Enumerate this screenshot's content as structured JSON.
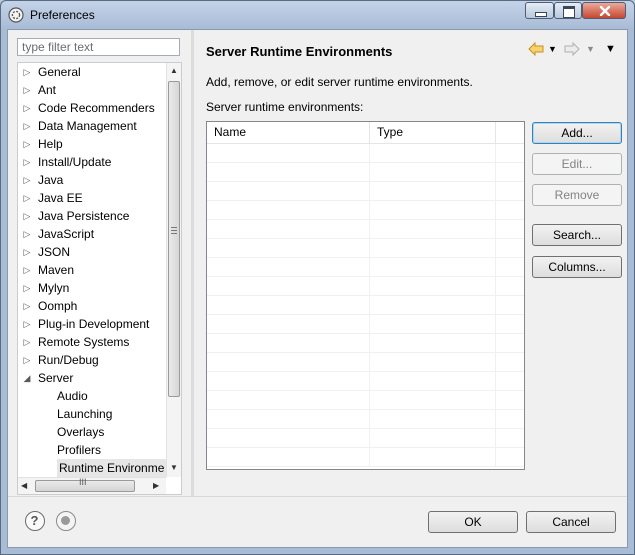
{
  "window": {
    "title": "Preferences"
  },
  "filter": {
    "placeholder": "type filter text"
  },
  "tree": {
    "items": [
      {
        "label": "General",
        "expandable": true,
        "selected": false,
        "level": 0
      },
      {
        "label": "Ant",
        "expandable": true,
        "selected": false,
        "level": 0
      },
      {
        "label": "Code Recommenders",
        "expandable": true,
        "selected": false,
        "level": 0
      },
      {
        "label": "Data Management",
        "expandable": true,
        "selected": false,
        "level": 0
      },
      {
        "label": "Help",
        "expandable": true,
        "selected": false,
        "level": 0
      },
      {
        "label": "Install/Update",
        "expandable": true,
        "selected": false,
        "level": 0
      },
      {
        "label": "Java",
        "expandable": true,
        "selected": false,
        "level": 0
      },
      {
        "label": "Java EE",
        "expandable": true,
        "selected": false,
        "level": 0
      },
      {
        "label": "Java Persistence",
        "expandable": true,
        "selected": false,
        "level": 0
      },
      {
        "label": "JavaScript",
        "expandable": true,
        "selected": false,
        "level": 0
      },
      {
        "label": "JSON",
        "expandable": true,
        "selected": false,
        "level": 0
      },
      {
        "label": "Maven",
        "expandable": true,
        "selected": false,
        "level": 0
      },
      {
        "label": "Mylyn",
        "expandable": true,
        "selected": false,
        "level": 0
      },
      {
        "label": "Oomph",
        "expandable": true,
        "selected": false,
        "level": 0
      },
      {
        "label": "Plug-in Development",
        "expandable": true,
        "selected": false,
        "level": 0
      },
      {
        "label": "Remote Systems",
        "expandable": true,
        "selected": false,
        "level": 0
      },
      {
        "label": "Run/Debug",
        "expandable": true,
        "selected": false,
        "level": 0
      },
      {
        "label": "Server",
        "expandable": true,
        "expanded": true,
        "selected": false,
        "level": 0
      },
      {
        "label": "Audio",
        "expandable": false,
        "selected": false,
        "level": 1
      },
      {
        "label": "Launching",
        "expandable": false,
        "selected": false,
        "level": 1
      },
      {
        "label": "Overlays",
        "expandable": false,
        "selected": false,
        "level": 1
      },
      {
        "label": "Profilers",
        "expandable": false,
        "selected": false,
        "level": 1
      },
      {
        "label": "Runtime Environme",
        "expandable": false,
        "selected": true,
        "level": 1
      }
    ],
    "hscroll_grip": "III"
  },
  "page": {
    "title": "Server Runtime Environments",
    "description": "Add, remove, or edit server runtime environments.",
    "list_label": "Server runtime environments:",
    "columns": [
      "Name",
      "Type"
    ],
    "rows": []
  },
  "buttons": {
    "add": "Add...",
    "edit": "Edit...",
    "remove": "Remove",
    "search": "Search...",
    "columns": "Columns..."
  },
  "footer": {
    "ok": "OK",
    "cancel": "Cancel"
  },
  "icons": {
    "back": "back-arrow-icon",
    "forward": "forward-arrow-icon",
    "help": "help-icon",
    "record": "record-icon",
    "app": "eclipse-icon"
  },
  "colors": {
    "nav_back": "#e8b43a",
    "nav_forward": "#b8b8b8",
    "default_button_border": "#3c7fb1"
  }
}
